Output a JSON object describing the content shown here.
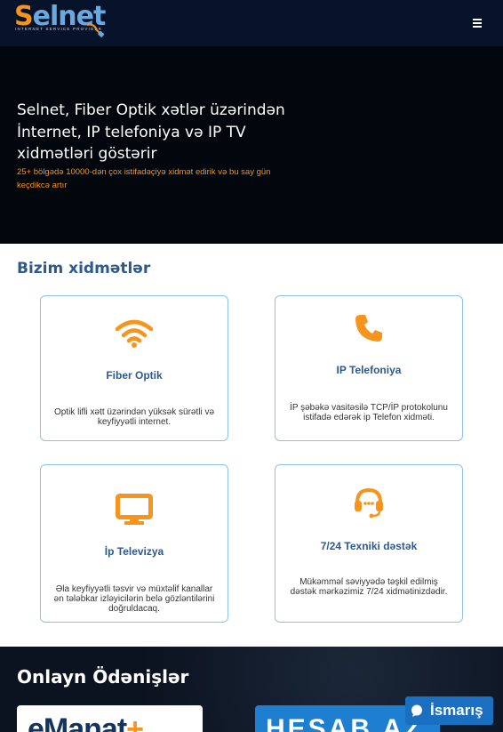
{
  "header": {
    "logo_text": "Selnet",
    "logo_tagline": "INTERNET SERVICE PROVIDER",
    "menu_icon": "hamburger-icon"
  },
  "hero": {
    "title": "Selnet, Fiber Optik xətlər üzərindən İnternet, IP telefoniya və IP TV xidmətləri göstərir",
    "subtitle": "25+ bölgədə 10000-dən çox istifadəçiyə xidmət edirik və bu say gün keçdikcə artır"
  },
  "services": {
    "title": "Bizim xidmətlər",
    "items": [
      {
        "title": "Fiber Optik",
        "desc": "Optik lifli xətt üzərindən yüksək sürətli və keyfiyyətli internet.",
        "icon": "wifi-icon"
      },
      {
        "title": "IP Telefoniya",
        "desc": "İP şəbəkə vasitəsilə TCP/İP protokolunu istifadə edərək ip Telefon xidməti.",
        "icon": "phone-icon"
      },
      {
        "title": "İp Televizya",
        "desc": "Əla keyfiyyətli təsvir və müxtəlif kanallar ən tələbkar izləyicilərin belə gözləntilərini doğruldacaq.",
        "icon": "tv-icon"
      },
      {
        "title": "7/24 Texniki dəstək",
        "desc": "Mükəmməl səviyyədə təşkil edilmiş dəstək mərkəzimiz 7/24 xidmətinizdədir.",
        "icon": "headset-icon"
      }
    ]
  },
  "payments": {
    "title": "Onlayn Ödənişlər",
    "provider1": "eManat",
    "provider1_plus": "+",
    "provider2": "HESAB.AZ"
  },
  "chat": {
    "label": "İsmarış",
    "icon": "chat-bubble-icon"
  },
  "colors": {
    "accent": "#f7941d",
    "brand_blue": "#2d5a8e",
    "header_bg": "#07132b"
  }
}
